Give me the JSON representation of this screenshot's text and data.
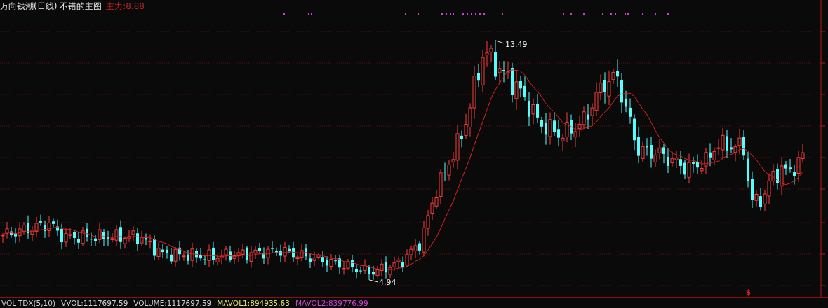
{
  "title": "万向钱潮(日线) 不错的主图",
  "indicator": {
    "label": "主力:",
    "value": "8.88"
  },
  "high_label": "13.49",
  "low_label": "4.94",
  "signal_mark": "$",
  "volume_legend": [
    {
      "text": "VOL-TDX(5,10)",
      "color": "#d0d0d0"
    },
    {
      "text": "VVOL:1117697.59",
      "color": "#d0d0d0"
    },
    {
      "text": "VOLUME:1117697.59",
      "color": "#d0d0d0"
    },
    {
      "text": "MAVOL1:894935.63",
      "color": "#e0e060"
    },
    {
      "text": "MAVOL2:839776.99",
      "color": "#d040d0"
    }
  ]
}
